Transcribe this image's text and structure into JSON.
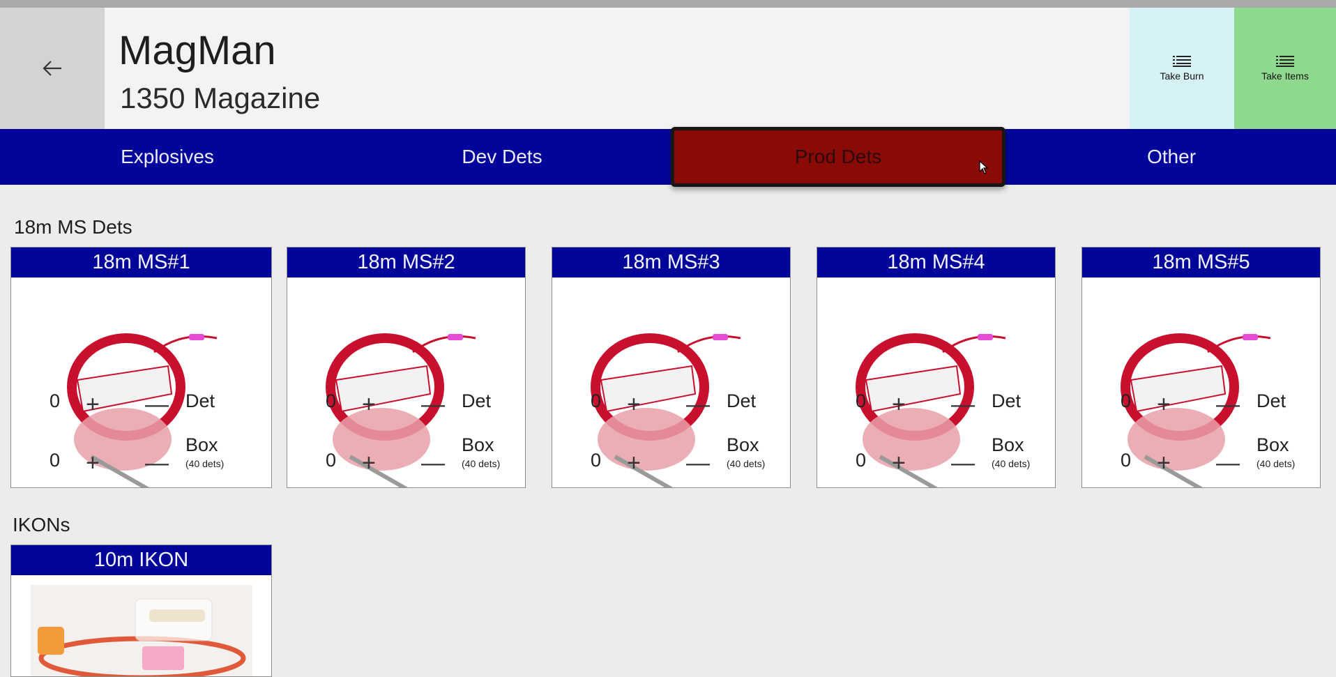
{
  "app": {
    "title": "MagMan",
    "subtitle": "1350 Magazine"
  },
  "header": {
    "back_icon": "back-arrow-icon",
    "take_burn_label": "Take Burn",
    "take_items_label": "Take Items",
    "list_icon": "list-icon"
  },
  "tabs": [
    {
      "label": "Explosives",
      "active": false
    },
    {
      "label": "Dev Dets",
      "active": false
    },
    {
      "label": "Prod Dets",
      "active": true
    },
    {
      "label": "Other",
      "active": false
    }
  ],
  "sections": [
    {
      "title": "18m MS Dets",
      "cards": [
        {
          "title": "18m MS#1",
          "det_qty": "0",
          "box_qty": "0"
        },
        {
          "title": "18m MS#2",
          "det_qty": "0",
          "box_qty": "0"
        },
        {
          "title": "18m MS#3",
          "det_qty": "0",
          "box_qty": "0"
        },
        {
          "title": "18m MS#4",
          "det_qty": "0",
          "box_qty": "0"
        },
        {
          "title": "18m MS#5",
          "det_qty": "0",
          "box_qty": "0"
        }
      ]
    },
    {
      "title": "IKONs",
      "cards": [
        {
          "title": "10m IKON"
        }
      ]
    }
  ],
  "labels": {
    "det": "Det",
    "box": "Box",
    "box_note": "(40 dets)",
    "plus": "+",
    "minus": "—"
  },
  "colors": {
    "accent_blue": "#03059a",
    "active_tab": "#8a0b05",
    "take_burn_bg": "#d6f2f7",
    "take_items_bg": "#8fd98f"
  }
}
